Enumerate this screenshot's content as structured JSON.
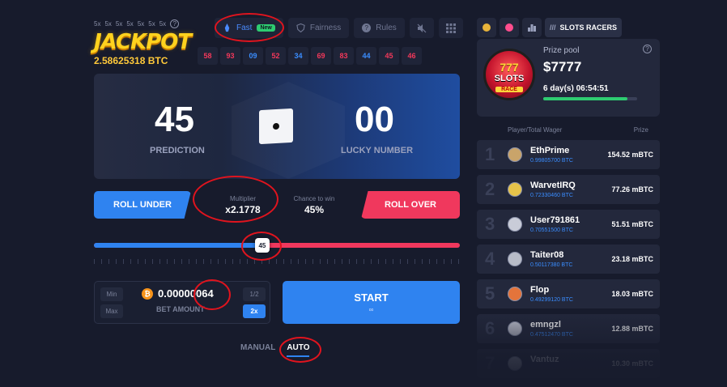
{
  "jackpot": {
    "multipliers": [
      "5x",
      "5x",
      "5x",
      "5x",
      "5x",
      "5x",
      "5x"
    ],
    "help": "?",
    "title": "JACKPOT",
    "amount": "2.58625318 BTC"
  },
  "topbar": {
    "fast_label": "Fast",
    "new_badge": "New",
    "fairness_label": "Fairness",
    "rules_label": "Rules",
    "icons": [
      "rocket-icon",
      "shield-icon",
      "help-icon",
      "sound-off-icon",
      "grid-icon"
    ]
  },
  "history": [
    {
      "value": "58",
      "color": "red"
    },
    {
      "value": "93",
      "color": "red"
    },
    {
      "value": "09",
      "color": "blue"
    },
    {
      "value": "52",
      "color": "red"
    },
    {
      "value": "34",
      "color": "blue"
    },
    {
      "value": "69",
      "color": "red"
    },
    {
      "value": "83",
      "color": "red"
    },
    {
      "value": "44",
      "color": "blue"
    },
    {
      "value": "45",
      "color": "red"
    },
    {
      "value": "46",
      "color": "red"
    }
  ],
  "game": {
    "prediction_value": "45",
    "prediction_label": "PREDICTION",
    "lucky_value": "00",
    "lucky_label": "LUCKY NUMBER",
    "roll_under": "ROLL UNDER",
    "roll_over": "ROLL OVER",
    "multiplier_label": "Multiplier",
    "multiplier_value": "x2.1778",
    "chance_label": "Chance to win",
    "chance_value": "45%",
    "slider_value": "45",
    "slider_fraction": 0.46
  },
  "bet": {
    "min_label": "Min",
    "max_label": "Max",
    "half_label": "1/2",
    "double_label": "2x",
    "amount": "0.00000064",
    "label": "BET AMOUNT",
    "coin_symbol": "₿"
  },
  "start": {
    "label": "START",
    "sub": "∞"
  },
  "modes": {
    "manual": "MANUAL",
    "auto": "AUTO"
  },
  "right_panel": {
    "tab_active": "SLOTS RACERS",
    "prize_label": "Prize pool",
    "prize_value": "$7777",
    "time_left": "6 day(s) 06:54:51",
    "time_progress": 0.9,
    "help": "?",
    "logo_line1": "777",
    "logo_line2": "SLOTS",
    "logo_line3": "RACE",
    "header_player": "Player/Total Wager",
    "header_prize": "Prize",
    "leaderboard": [
      {
        "rank": "1",
        "name": "EthPrime",
        "wager": "0.99805700 BTC",
        "prize": "154.52 mBTC"
      },
      {
        "rank": "2",
        "name": "WarvetIRQ",
        "wager": "0.72330460 BTC",
        "prize": "77.26 mBTC"
      },
      {
        "rank": "3",
        "name": "User791861",
        "wager": "0.70551500 BTC",
        "prize": "51.51 mBTC"
      },
      {
        "rank": "4",
        "name": "Taiter08",
        "wager": "0.50117380 BTC",
        "prize": "23.18 mBTC"
      },
      {
        "rank": "5",
        "name": "Flop",
        "wager": "0.49299120 BTC",
        "prize": "18.03 mBTC"
      },
      {
        "rank": "6",
        "name": "emngzl",
        "wager": "0.47512470 BTC",
        "prize": "12.88 mBTC"
      },
      {
        "rank": "7",
        "name": "Vantuz",
        "wager": "",
        "prize": "10.30 mBTC"
      }
    ]
  },
  "colors": {
    "accent_blue": "#2f83f0",
    "accent_red": "#f0385d",
    "jackpot_gold": "#ffd21e",
    "background": "#171b2c"
  }
}
